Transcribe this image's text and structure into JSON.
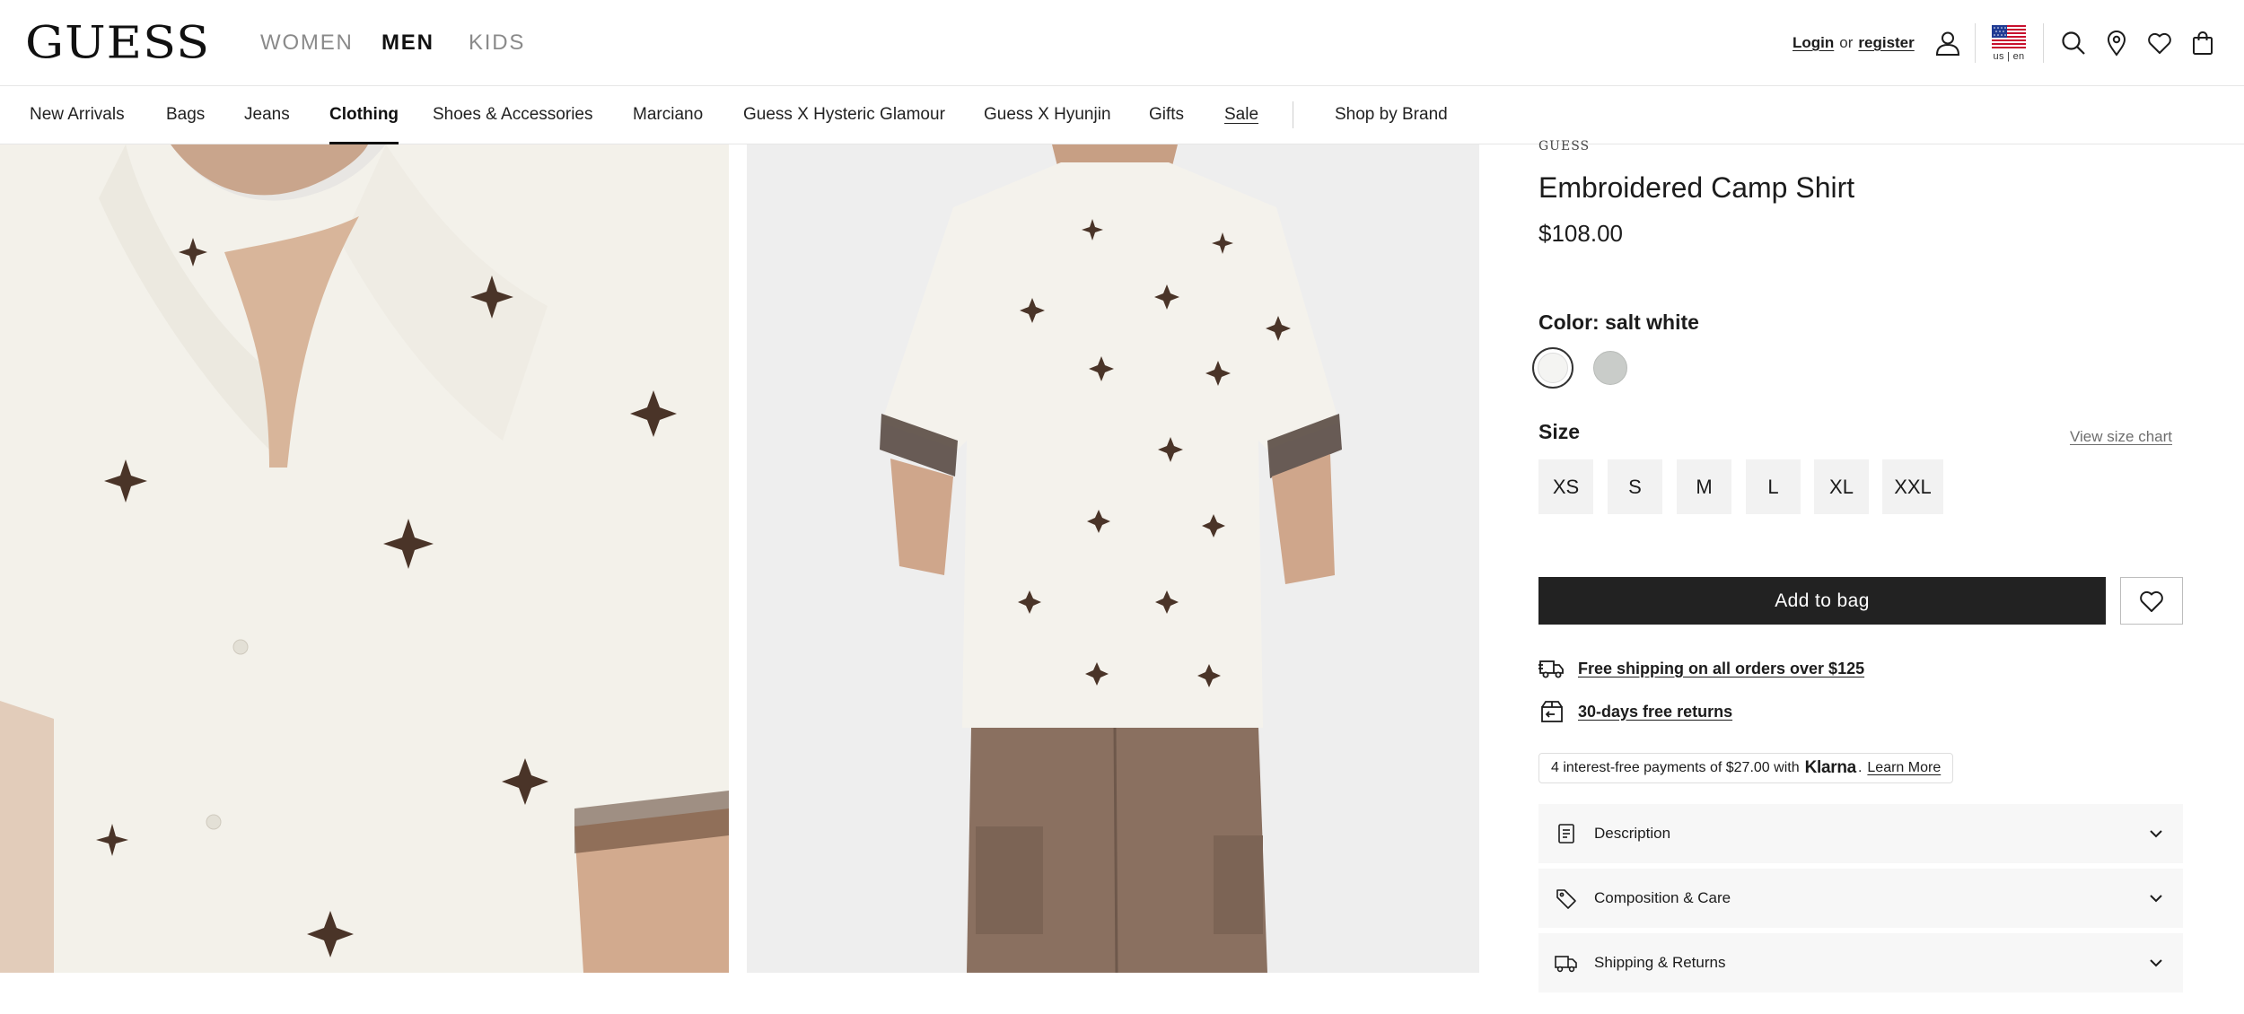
{
  "header": {
    "logo": "GUESS",
    "departments": [
      {
        "label": "WOMEN",
        "active": false
      },
      {
        "label": "MEN",
        "active": true
      },
      {
        "label": "KIDS",
        "active": false
      }
    ],
    "login_label": "Login",
    "or_label": "or",
    "register_label": "register",
    "locale": "us | en",
    "icons": [
      "account-icon",
      "us-flag-icon",
      "search-icon",
      "store-locator-icon",
      "wishlist-icon",
      "shopping-bag-icon"
    ]
  },
  "category_nav": {
    "items": [
      "New Arrivals",
      "Bags",
      "Jeans",
      "Clothing",
      "Shoes & Accessories",
      "Marciano",
      "Guess X Hysteric Glamour",
      "Guess X Hyunjin",
      "Gifts",
      "Sale"
    ],
    "active": "Clothing",
    "shop_by_brand": "Shop by Brand"
  },
  "product": {
    "brand": "GUESS",
    "title": "Embroidered Camp Shirt",
    "price": "$108.00",
    "color_label": "Color:",
    "color_value": "salt white",
    "swatches": [
      {
        "name": "salt white",
        "color": "#f4f4f2",
        "selected": true
      },
      {
        "name": "grey",
        "color": "#c9ccc9",
        "selected": false
      }
    ],
    "size_label": "Size",
    "size_chart_link": "View size chart",
    "sizes": [
      "XS",
      "S",
      "M",
      "L",
      "XL",
      "XXL"
    ],
    "add_to_bag": "Add to bag",
    "perks": {
      "shipping": "Free shipping on all orders over $125",
      "returns": "30-days free returns"
    },
    "klarna": {
      "text": "4 interest-free payments of $27.00 with",
      "brand": "Klarna",
      "punct": ".",
      "learn_more": "Learn More"
    },
    "accordions": [
      "Description",
      "Composition & Care",
      "Shipping & Returns"
    ]
  },
  "colors": {
    "primary_button": "#222222",
    "accordion_bg": "#f7f7f7",
    "size_bg": "#f2f2f2"
  }
}
